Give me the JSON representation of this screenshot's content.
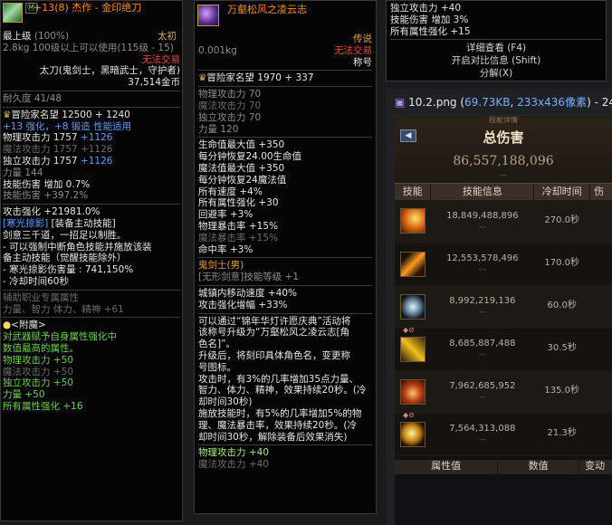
{
  "panel1": {
    "tag": "Ⓜ",
    "title": "+13(8) 杰作 - 金印绝刀",
    "grade": "最上级",
    "grade_pct": "(100%)",
    "item_type": "太初",
    "weight_line": "2.8kg   100级以上可以使用(115级 - 15)",
    "untradeable": "无法交易",
    "classes": "太刀(鬼剑士，黑暗武士，守护者)",
    "price": "37,514金币",
    "durability": "耐久度 41/48",
    "adventure_title": "冒险家名望 12500 + 1240",
    "reinforce": "+13 强化，+8 锻造  性能适用",
    "stats": [
      {
        "label": "物理攻击力 1757",
        "bonus": "+1126",
        "dim": false
      },
      {
        "label": "魔法攻击力 1757",
        "bonus": "+1126",
        "dim": true
      },
      {
        "label": "独立攻击力 1757",
        "bonus": "+1126",
        "dim": false
      },
      {
        "label": "力量 144",
        "bonus": "",
        "dim": false
      }
    ],
    "skill_damage": "技能伤害 增加 0.7%",
    "skill_damage2": "技能伤害 +397.2%",
    "attack_boost": "攻击强化 +21981.0%",
    "skill_name": "[寒光掠影]",
    "skill_note": "[装备主动技能]",
    "desc1": "剑意三千道，一招足以制胜。",
    "desc2": "- 可以强制中断角色技能并施放该装",
    "desc3": "备主动技能（觉醒技能除外）",
    "desc4": "- 寒光掠影伤害量 : 741,150%",
    "desc5": "- 冷却时间60秒",
    "aux_title": "辅助职业专属属性",
    "aux_stats": "力量、智力 体力、精神 +61",
    "enchant_title": "<附魔>",
    "enchant_desc1": "对武器赋予自身属性强化中",
    "enchant_desc2": "数值最高的属性。",
    "enchant_stats": [
      "物理攻击力 +50",
      "魔法攻击力 +50",
      "独立攻击力 +50",
      "力量 +50",
      "所有属性强化 +16"
    ]
  },
  "panel2": {
    "title": "万壑松风之凌云志",
    "status1": "传说",
    "status2": "无法交易",
    "status3": "称号",
    "weight": "0.001kg",
    "adventure_title": "冒险家名望 1970 + 337",
    "base_stats": [
      "物理攻击力 70",
      "魔法攻击力 70",
      "独立攻击力 70",
      "力量 120"
    ],
    "bonus_stats": [
      "生命值最大值 +350",
      "每分钟恢复24.00生命值",
      "魔法值最大值 +350",
      "每分钟恢复24魔法值",
      "所有速度 +4%",
      "所有属性强化 +30",
      "回避率 +3%",
      "物理暴击率 +15%",
      "魔法暴击率 +15%",
      "命中率 +3%"
    ],
    "class_line": "鬼剑士(男)",
    "skill_line": "[无形剑意]技能等级 +1",
    "move_speed": "城镇内移动速度 +40%",
    "attack_amp": "攻击强化增幅 +33%",
    "desc": [
      "可以通过“锦年华灯许愿庆典”活动将",
      "该称号升级为“万壑松风之凌云志[角",
      "色名]”。",
      "升级后，将刻印具体角色名，变更称",
      "号图标。",
      "攻击时，有3%的几率增加35点力量、",
      "智力、体力、精神，效果持续20秒。(冷",
      "却时间30秒)",
      "施放技能时，有5%的几率增加5%的物",
      "理、魔法暴击率，效果持续20秒。(冷",
      "却时间30秒，解除装备后效果消失)"
    ],
    "footer_stats": [
      "物理攻击力 +40",
      "魔法攻击力 +40"
    ]
  },
  "panel3": {
    "line1": "独立攻击力 +40",
    "line2": "技能伤害 增加 3%",
    "line3": "所有属性强化 +15",
    "btn_detail": "详细查看 (F4)",
    "btn_compare": "开启对比信息 (Shift)",
    "btn_disassemble": "分解(X)"
  },
  "viewer": {
    "filename": "10.2.png",
    "size": "69.73KB",
    "dims": "233x436像素",
    "trail": "- 24"
  },
  "damage": {
    "top_strip": "技能详情",
    "heading": "总伤害",
    "total": "86,557,188,096",
    "total_sub": "—",
    "columns": [
      "技能",
      "技能信息",
      "冷却时间",
      "伤"
    ],
    "rows": [
      {
        "dmg": "18,849,488,896",
        "cd": "270.0秒",
        "sub": "—"
      },
      {
        "dmg": "12,553,578,496",
        "cd": "170.0秒",
        "sub": "—"
      },
      {
        "dmg": "8,992,219,136",
        "cd": "60.0秒",
        "sub": "—"
      },
      {
        "dmg": "8,685,887,488",
        "cd": "30.5秒",
        "sub": "—"
      },
      {
        "dmg": "7,962,685,952",
        "cd": "135.0秒",
        "sub": "—"
      },
      {
        "dmg": "7,564,313,088",
        "cd": "21.3秒",
        "sub": "—"
      }
    ],
    "footer_cols": [
      "属性值",
      "数值",
      "变动"
    ]
  }
}
